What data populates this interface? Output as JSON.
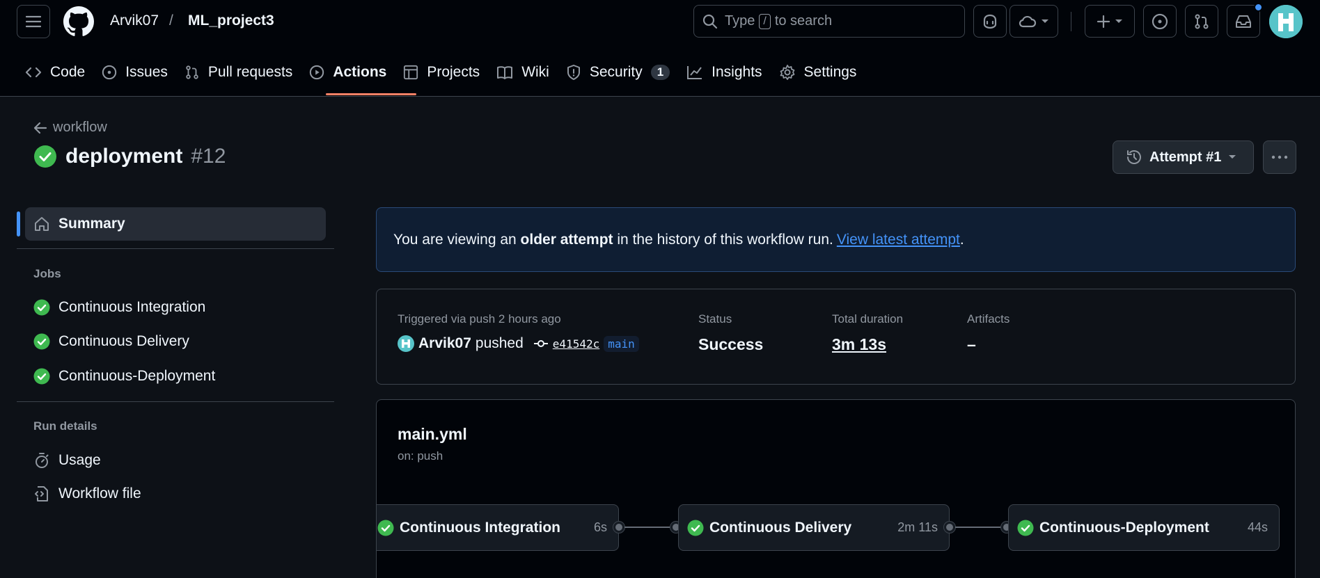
{
  "header": {
    "owner": "Arvik07",
    "separator": "/",
    "repo": "ML_project3",
    "search_prefix": "Type",
    "search_key": "/",
    "search_suffix": "to search"
  },
  "tabs": [
    {
      "label": "Code",
      "icon": "code-icon"
    },
    {
      "label": "Issues",
      "icon": "issue-icon"
    },
    {
      "label": "Pull requests",
      "icon": "pull-request-icon"
    },
    {
      "label": "Actions",
      "icon": "play-icon",
      "active": true
    },
    {
      "label": "Projects",
      "icon": "table-icon"
    },
    {
      "label": "Wiki",
      "icon": "book-icon"
    },
    {
      "label": "Security",
      "icon": "shield-icon",
      "counter": "1"
    },
    {
      "label": "Insights",
      "icon": "graph-icon"
    },
    {
      "label": "Settings",
      "icon": "gear-icon"
    }
  ],
  "page": {
    "back_label": "workflow",
    "run_name": "deployment",
    "run_number": "#12",
    "attempt_label": "Attempt #1"
  },
  "sidebar": {
    "summary": "Summary",
    "jobs_heading": "Jobs",
    "jobs": [
      "Continuous Integration",
      "Continuous Delivery",
      "Continuous-Deployment"
    ],
    "run_details_heading": "Run details",
    "usage": "Usage",
    "workflow_file": "Workflow file"
  },
  "flash": {
    "prefix": "You are viewing an",
    "bold": "older attempt",
    "middle": "in the history of this workflow run.",
    "link": "View latest attempt",
    "suffix": "."
  },
  "meta": {
    "trigger_label": "Triggered via push 2 hours ago",
    "actor": "Arvik07",
    "action": "pushed",
    "sha": "e41542c",
    "branch": "main",
    "status_label": "Status",
    "status_value": "Success",
    "duration_label": "Total duration",
    "duration_value": "3m 13s",
    "artifacts_label": "Artifacts",
    "artifacts_value": "–"
  },
  "graph": {
    "file": "main.yml",
    "trigger": "on: push",
    "jobs": [
      {
        "name": "Continuous Integration",
        "time": "6s"
      },
      {
        "name": "Continuous Delivery",
        "time": "2m 11s"
      },
      {
        "name": "Continuous-Deployment",
        "time": "44s"
      }
    ]
  },
  "colors": {
    "success": "#3fb950",
    "accent": "#4493f8",
    "active_tab": "#f78166"
  }
}
